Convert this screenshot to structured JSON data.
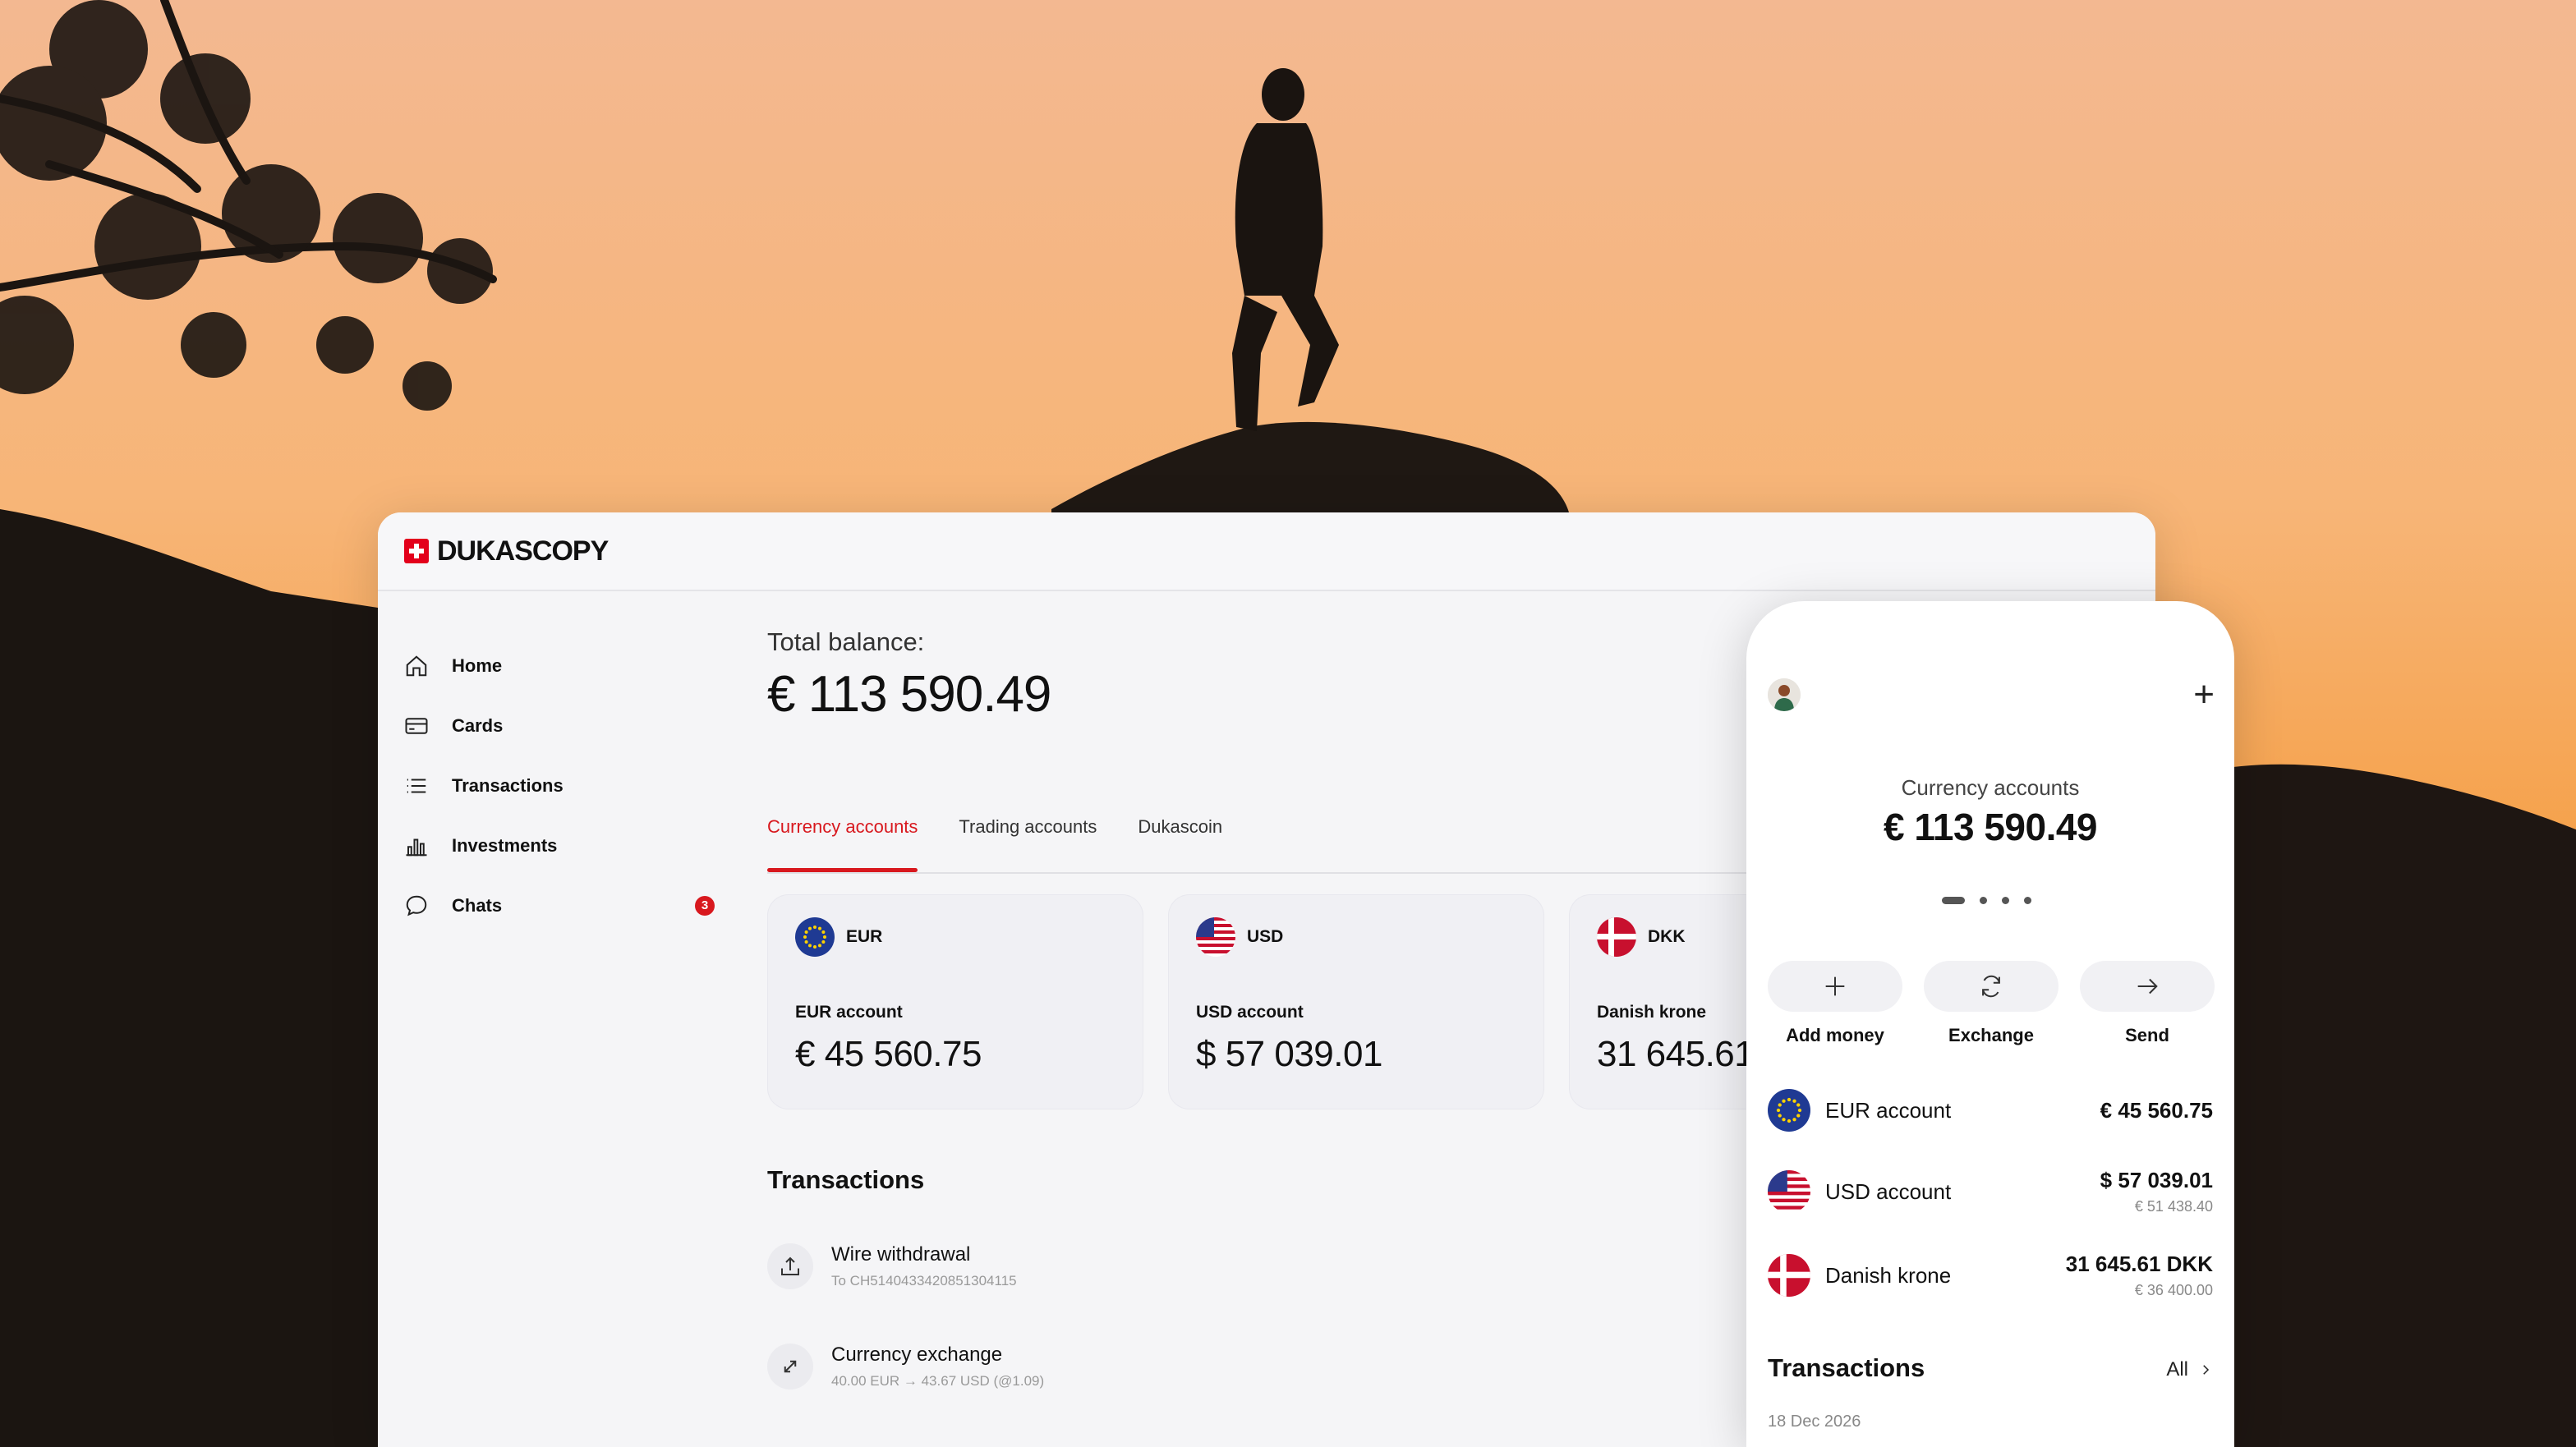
{
  "brand": {
    "name": "DUKASCOPY"
  },
  "sidebar": {
    "items": [
      {
        "label": "Home",
        "icon": "home-icon"
      },
      {
        "label": "Cards",
        "icon": "card-icon"
      },
      {
        "label": "Transactions",
        "icon": "list-icon"
      },
      {
        "label": "Investments",
        "icon": "bar-chart-icon"
      },
      {
        "label": "Chats",
        "icon": "chat-icon",
        "badge": "3"
      }
    ]
  },
  "main": {
    "total_label": "Total balance:",
    "total_value": "€ 113 590.49",
    "tabs": [
      {
        "label": "Currency accounts",
        "active": true
      },
      {
        "label": "Trading accounts",
        "active": false
      },
      {
        "label": "Dukascoin",
        "active": false
      }
    ],
    "accounts": [
      {
        "code": "EUR",
        "name": "EUR account",
        "amount": "€ 45 560.75",
        "flag": "eu-flag-icon"
      },
      {
        "code": "USD",
        "name": "USD account",
        "amount": "$ 57 039.01",
        "flag": "us-flag-icon"
      },
      {
        "code": "DKK",
        "name": "Danish krone",
        "amount": "31 645.61",
        "flag": "dk-flag-icon"
      }
    ],
    "transactions_title": "Transactions",
    "transactions": [
      {
        "name": "Wire withdrawal",
        "sub": "To CH5140433420851304115",
        "icon": "upload-icon"
      },
      {
        "name": "Currency exchange",
        "sub": "40.00 EUR → 43.67 USD (@1.09)",
        "icon": "exchange-icon"
      }
    ]
  },
  "phone": {
    "plus": "+",
    "label": "Currency accounts",
    "balance": "€ 113 590.49",
    "actions": [
      {
        "label": "Add money",
        "icon": "plus-icon"
      },
      {
        "label": "Exchange",
        "icon": "refresh-icon"
      },
      {
        "label": "Send",
        "icon": "arrow-right-icon"
      }
    ],
    "accounts": [
      {
        "name": "EUR account",
        "amount": "€ 45 560.75",
        "sub": ""
      },
      {
        "name": "USD account",
        "amount": "$ 57 039.01",
        "sub": "€ 51 438.40"
      },
      {
        "name": "Danish krone",
        "amount": "31 645.61 DKK",
        "sub": "€ 36 400.00"
      }
    ],
    "transactions_title": "Transactions",
    "all_label": "All",
    "date": "18 Dec 2026"
  },
  "colors": {
    "accent": "#d8181e",
    "sky_top": "#f3b68a",
    "sky_bottom": "#e8902f"
  }
}
